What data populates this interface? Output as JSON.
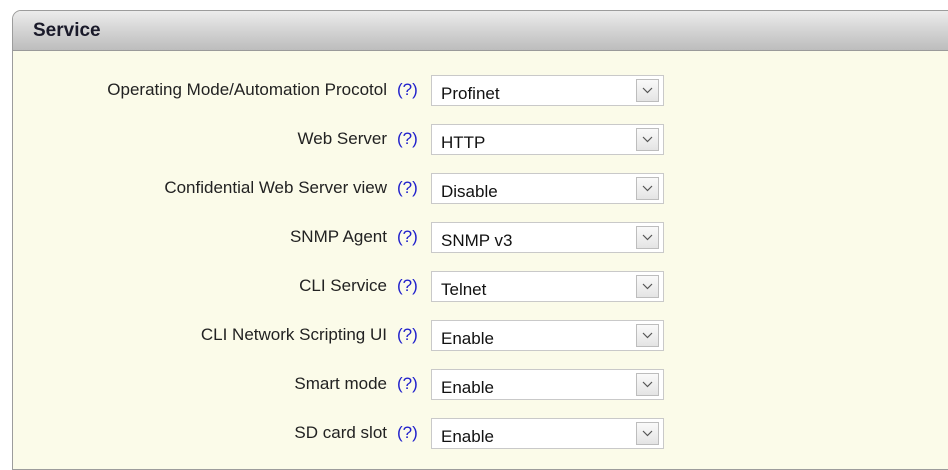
{
  "panel": {
    "title": "Service"
  },
  "help_label": "(?)",
  "fields": [
    {
      "label": "Operating Mode/Automation Procotol",
      "value": "Profinet"
    },
    {
      "label": "Web Server",
      "value": "HTTP"
    },
    {
      "label": "Confidential Web Server view",
      "value": "Disable"
    },
    {
      "label": "SNMP Agent",
      "value": "SNMP v3"
    },
    {
      "label": "CLI Service",
      "value": "Telnet"
    },
    {
      "label": "CLI Network Scripting UI",
      "value": "Enable"
    },
    {
      "label": "Smart mode",
      "value": "Enable"
    },
    {
      "label": "SD card slot",
      "value": "Enable"
    }
  ],
  "icons": {
    "dropdown": "chevron-down-icon"
  },
  "colors": {
    "panel_background": "#fbfbe9",
    "help_link": "#2222cc",
    "header_gradient_top": "#ececec",
    "header_gradient_bottom": "#bdbdbd"
  }
}
